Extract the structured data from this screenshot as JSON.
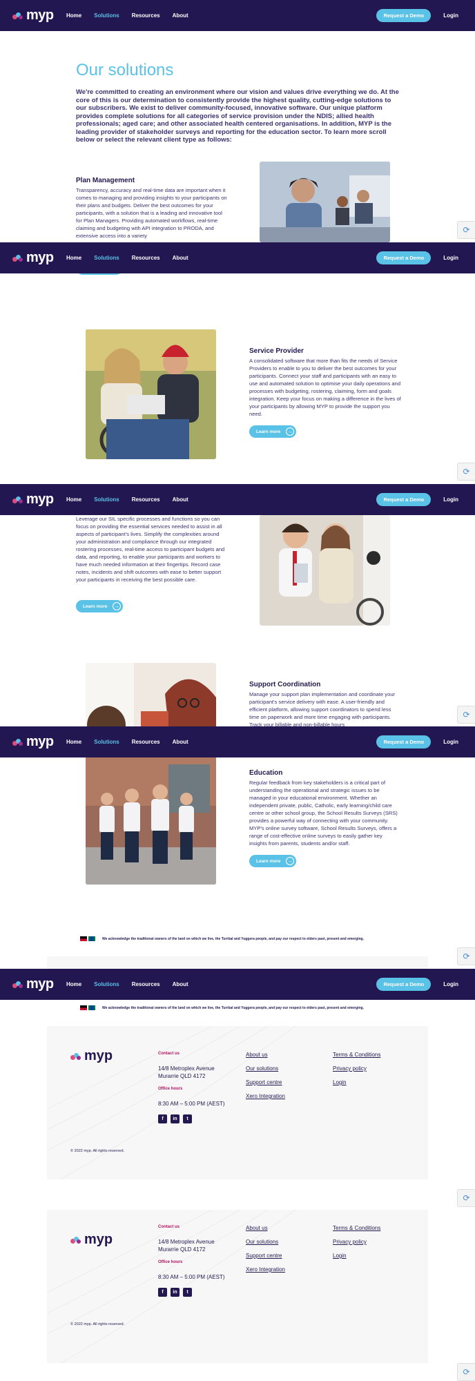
{
  "nav": {
    "logo": "myp",
    "home": "Home",
    "solutions": "Solutions",
    "resources": "Resources",
    "about": "About",
    "demo": "Request a Demo",
    "login": "Login"
  },
  "page": {
    "title": "Our solutions",
    "intro": "We're committed to creating an environment where our vision and values drive everything we do. At the core of this is our determination to consistently provide the highest quality, cutting-edge solutions to our subscribers. We exist to deliver community-focused, innovative software.  Our unique platform provides complete solutions for all categories of service provision under the NDIS;  allied health professionals;  aged care;  and other associated health centered organisations.  In addition, MYP is the leading provider of stakeholder surveys and reporting for the education sector.  To learn more scroll below or select the relevant client type as follows:"
  },
  "sections": {
    "plan": {
      "title": "Plan Management",
      "body": "Transparency, accuracy and real-time data are important when it comes to managing and providing insights to your participants on their plans and budgets. Deliver the best outcomes for your participants, with a solution that is a leading and innovative tool for Plan Managers. Providing automated workflows, real-time claiming and budgeting with API integration to PRODA, and extensive access into a variety"
    },
    "service": {
      "title": "Service Provider",
      "body": "A consolidated software that more than fits the needs of Service Providers to enable to you to deliver the best outcomes for your participants. Connect your staff and participants with an easy to use and automated solution to optimise your daily operations and processes with budgeting, rostering, claiming, form and goals integration. Keep your focus on making a difference in the lives of your participants by allowing MYP to provide the support you need.",
      "button": "Learn more"
    },
    "sil": {
      "body": "Leverage our SIL specific processes and functions so you can focus on providing the essential services needed to assist in all aspects of participant's lives. Simplify the complexities around your administration and compliance through our integrated rostering processes, real-time access to participant budgets and data, and reporting, to enable your participants and workers to have much needed information at their fingertips. Record case notes, incidents and shift outcomes with ease to better support your participants in receiving the best possible care.",
      "button": "Learn more"
    },
    "support": {
      "title": "Support Coordination",
      "body": "Manage your support plan implementation and coordinate your participant's service delivery with ease. A user-friendly and efficient platform, allowing support coordinators to spend less time on paperwork and more time engaging with participants. Track your billable and non-billable hours"
    },
    "education": {
      "title": "Education",
      "body": "Regular feedback from key stakeholders is a critical part of understanding the operational and strategic issues to be managed in your educational environment. Whether an independent private, public, Catholic, early learning/child care centre or other school group, the School Results Surveys (SRS) provides a powerful way of connecting with your community. MYP's online survey software, School Results Surveys, offers a range of cost-effective online surveys to easily gather key insights from parents, students and/or staff.",
      "button": "Learn more"
    }
  },
  "ack": "We acknowledge the traditional owners of the land on which we live, the Turrbal and Yuggera people, and pay our respect to elders past, present and emerging.",
  "footer": {
    "logo": "myp",
    "contact_head": "Contact us",
    "address1": "14/8 Metroplex Avenue",
    "address2": "Murarrie QLD 4172",
    "hours_head": "Office hours",
    "hours": "8:30 AM – 5:00 PM (AEST)",
    "links1": [
      "About us",
      "Our solutions",
      "Support centre",
      "Xero Integration"
    ],
    "links2": [
      "Terms & Conditions",
      "Privacy policy",
      "Login"
    ],
    "copyright": "© 2022 myp.  All rights reserved.",
    "social": [
      "f",
      "in",
      "t"
    ]
  },
  "colors": {
    "navy": "#221751",
    "accent": "#5bc2e7",
    "magenta": "#b3125f"
  }
}
